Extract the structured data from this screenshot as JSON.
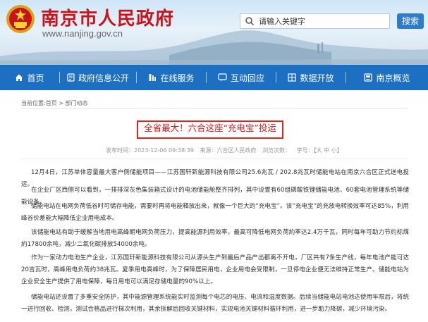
{
  "header": {
    "site_title": "南京市人民政府",
    "site_url": "www.nanjing.gov.cn",
    "search_placeholder": "请输入关键字",
    "search_button": "搜索"
  },
  "nav": {
    "items": [
      {
        "label": "首页",
        "icon": "home-icon"
      },
      {
        "label": "政府信息公开",
        "icon": "document-icon"
      },
      {
        "label": "在线服务",
        "icon": "service-icon"
      },
      {
        "label": "互动回应",
        "icon": "chat-icon"
      },
      {
        "label": "数据开放",
        "icon": "data-icon"
      },
      {
        "label": "南京概览",
        "icon": "overview-icon"
      }
    ]
  },
  "article": {
    "breadcrumb": "当前位置:首页 > 部门动态",
    "title": "全省最大！六合这座“充电宝”投运",
    "date": "发布时间：2023-12-06 09:38:39",
    "source": "来源：六合区人民政府",
    "views": "浏览次数：",
    "font_size": "字号：【大 中 小】",
    "paragraphs": [
      "12月4日，江苏单体容量最大客户侧储能项目——江苏国轩新能源科技有限公司25.6兆瓦 / 202.8兆瓦时储能电站在南京六合区正式送电投运。",
      "在企业厂区西侧可以看到，一排排深灰色集装箱式设计的电池储能舱整齐排列，其中设置有60组磷酸铁锂储能电池、60套电池管理系统等储能设备。",
      "储能电站在电网负荷低谷时可储存电能，需要时再将电能释放出来，就像一个巨大的“充电宝”。该“充电宝”的充放电转换效率可达85%，利用峰谷价差能大幅降低企业用电成本。",
      "该储能电站有助于缓解当地用电高峰期电网负荷压力，提高能源利用效率，最高可降低电网负荷約率达2.4万千瓦，同时每年可助力节约标煤約17800余吨，减少二氧化碳排放54000余吨。",
      "作为一家动力电池生产企业，江苏国轩新能源科技有限公司从源头生产到最后产品产出都离不开电，厂区共有7条生产线，每年电池产能可达20吉瓦时，高峰用电负荷约38兆瓦。夏季用电高峰时，为了保障居民用电，企业用电会受限制，一旦停电企业便无法维持正常生产。储能电站为企业安全生产提供了用电保障，每日用电可以满足存储电量的90%以上。",
      "储能电站还设置了多重安全防护，其中能源管理系统能实时监测每个电芯的电压、电流和温度数据。后续当储能电站电池达使用年限后，将统一进行回收、检测，测试合格品进行梯次利用，其余拆解后回收关键材料，实现电池关键材料循环利用，进一步助力降碳，减少环境污染。"
    ]
  }
}
